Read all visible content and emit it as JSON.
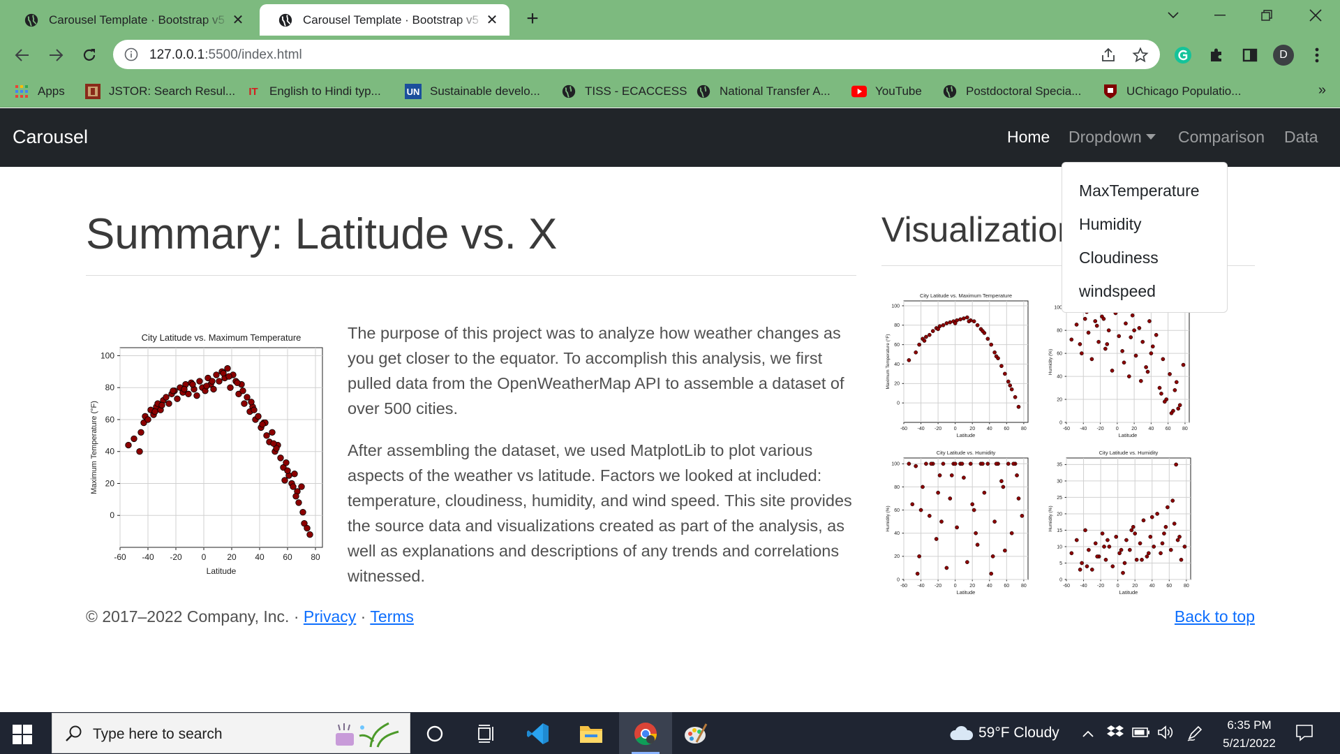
{
  "browser": {
    "tabs": [
      {
        "title": "Carousel Template · Bootstrap v5",
        "active": false
      },
      {
        "title": "Carousel Template · Bootstrap v5",
        "active": true
      }
    ],
    "url_host": "127.0.0.1",
    "url_path": ":5500/index.html",
    "profile_initial": "D",
    "bookmarks": [
      {
        "label": "Apps",
        "icon": "apps-grid-icon"
      },
      {
        "label": "JSTOR: Search Resul...",
        "icon": "jstor-icon"
      },
      {
        "label": "English to Hindi typ...",
        "icon": "it-icon",
        "glyph": "IT"
      },
      {
        "label": "Sustainable develo...",
        "icon": "un-icon",
        "glyph": "UN"
      },
      {
        "label": "TISS - ECACCESS",
        "icon": "globe-icon"
      },
      {
        "label": "National Transfer A...",
        "icon": "globe-icon"
      },
      {
        "label": "YouTube",
        "icon": "youtube-icon"
      },
      {
        "label": "Postdoctoral Specia...",
        "icon": "globe-icon"
      },
      {
        "label": "UChicago Populatio...",
        "icon": "uchicago-icon"
      }
    ],
    "more_bookmarks": "»"
  },
  "navbar": {
    "brand": "Carousel",
    "links": [
      {
        "label": "Home",
        "active": true
      },
      {
        "label": "Dropdown",
        "active": false
      },
      {
        "label": "Comparison",
        "active": false
      },
      {
        "label": "Data",
        "active": false
      }
    ],
    "dropdown_items": [
      "MaxTemperature",
      "Humidity",
      "Cloudiness",
      "windspeed"
    ]
  },
  "main": {
    "summary_title": "Summary: Latitude vs. X",
    "paragraph_1": "The purpose of this project was to analyze how weather changes as you get closer to the equator. To accomplish this analysis, we first pulled data from the OpenWeatherMap API to assemble a dataset of over 500 cities.",
    "paragraph_2": "After assembling the dataset, we used MatplotLib to plot various aspects of the weather vs latitude. Factors we looked at included: temperature, cloudiness, humidity, and wind speed. This site provides the source data and visualizations created as part of the analysis, as well as explanations and descriptions of any trends and correlations witnessed.",
    "visualizations_title": "Visualizations"
  },
  "footer": {
    "copyright": "© 2017–2022 Company, Inc. · ",
    "privacy": "Privacy",
    "separator": " · ",
    "terms": "Terms",
    "back_to_top": "Back to top"
  },
  "taskbar": {
    "search_placeholder": "Type here to search",
    "weather": "59°F  Cloudy",
    "time": "6:35 PM",
    "date": "5/21/2022"
  },
  "colors": {
    "navbar_bg": "#212529",
    "chrome_green": "#7dba7f",
    "link": "#0d6efd",
    "marker": "#8b0000"
  },
  "chart_data": [
    {
      "type": "scatter",
      "title": "City Latitude vs. Maximum Temperature",
      "xlabel": "Latitude",
      "ylabel": "Maximum Temperature (°F)",
      "xlim": [
        -60,
        85
      ],
      "ylim": [
        -20,
        105
      ],
      "xticks": [
        -60,
        -40,
        -20,
        0,
        20,
        40,
        60,
        80
      ],
      "yticks": [
        0,
        20,
        40,
        60,
        80,
        100
      ],
      "grid": true,
      "x": [
        -54,
        -50,
        -46,
        -45,
        -43,
        -42,
        -40,
        -38,
        -36,
        -34,
        -33,
        -31,
        -29,
        -27,
        -25,
        -23,
        -21,
        -19,
        -17,
        -15,
        -13,
        -11,
        -9,
        -7,
        -5,
        -3,
        -1,
        1,
        3,
        5,
        7,
        9,
        11,
        13,
        15,
        17,
        19,
        21,
        23,
        25,
        27,
        29,
        31,
        33,
        35,
        37,
        39,
        41,
        43,
        45,
        47,
        49,
        51,
        53,
        55,
        57,
        59,
        61,
        63,
        65,
        67,
        68,
        70,
        72,
        74,
        76,
        -35,
        -22,
        -8,
        6,
        18,
        28,
        36,
        44,
        52,
        60,
        66,
        -30,
        -14,
        2,
        14,
        24,
        34,
        42,
        50,
        58,
        64,
        71
      ],
      "y": [
        44,
        48,
        40,
        52,
        58,
        62,
        60,
        66,
        63,
        68,
        70,
        66,
        72,
        74,
        70,
        76,
        78,
        73,
        80,
        77,
        82,
        76,
        83,
        79,
        75,
        84,
        80,
        78,
        86,
        82,
        79,
        88,
        84,
        90,
        86,
        92,
        80,
        88,
        84,
        76,
        82,
        70,
        74,
        65,
        68,
        60,
        62,
        55,
        58,
        50,
        46,
        52,
        40,
        44,
        36,
        30,
        33,
        25,
        20,
        26,
        15,
        8,
        18,
        -5,
        -8,
        -12,
        65,
        78,
        82,
        84,
        87,
        78,
        66,
        58,
        42,
        28,
        12,
        69,
        79,
        81,
        89,
        83,
        71,
        57,
        45,
        22,
        18,
        2
      ],
      "marker_color": "#8b0000"
    },
    {
      "type": "scatter",
      "title": "City Latitude vs. Maximum Temperature",
      "xlabel": "Latitude",
      "ylabel": "Maximum Temperature (°F)",
      "xlim": [
        -60,
        85
      ],
      "ylim": [
        -20,
        105
      ],
      "xticks": [
        -60,
        -40,
        -20,
        0,
        20,
        40,
        60,
        80
      ],
      "yticks": [
        0,
        20,
        40,
        60,
        80,
        100
      ],
      "grid": true,
      "x": [
        -54,
        -46,
        -42,
        -38,
        -34,
        -30,
        -26,
        -22,
        -18,
        -14,
        -10,
        -6,
        -2,
        2,
        6,
        10,
        14,
        18,
        22,
        26,
        30,
        34,
        38,
        42,
        46,
        50,
        54,
        58,
        62,
        66,
        70,
        74,
        -36,
        -20,
        0,
        16,
        32,
        48,
        64
      ],
      "y": [
        44,
        52,
        60,
        66,
        68,
        70,
        74,
        77,
        79,
        80,
        82,
        83,
        84,
        85,
        86,
        87,
        88,
        85,
        84,
        80,
        76,
        72,
        66,
        60,
        52,
        46,
        38,
        30,
        22,
        14,
        6,
        -4,
        64,
        76,
        82,
        84,
        74,
        48,
        18
      ],
      "marker_color": "#8b0000"
    },
    {
      "type": "scatter",
      "title": "",
      "xlabel": "Latitude",
      "ylabel": "Humidity (%)",
      "xlim": [
        -60,
        85
      ],
      "ylim": [
        0,
        105
      ],
      "xticks": [
        -60,
        -40,
        -20,
        0,
        20,
        40,
        60,
        80
      ],
      "yticks": [
        0,
        20,
        40,
        60,
        80,
        100
      ],
      "grid": true,
      "x": [
        -54,
        -48,
        -42,
        -38,
        -34,
        -30,
        -26,
        -22,
        -18,
        -14,
        -10,
        -6,
        -2,
        2,
        6,
        10,
        14,
        18,
        22,
        26,
        30,
        34,
        38,
        42,
        46,
        50,
        54,
        58,
        62,
        66,
        70,
        74,
        78,
        -36,
        -24,
        -12,
        4,
        16,
        28,
        40,
        52,
        64,
        72,
        -44,
        -16,
        8,
        20,
        36,
        56,
        68
      ],
      "y": [
        72,
        85,
        60,
        90,
        78,
        55,
        88,
        70,
        92,
        64,
        80,
        45,
        95,
        75,
        62,
        86,
        40,
        93,
        58,
        82,
        70,
        48,
        88,
        66,
        76,
        30,
        55,
        20,
        42,
        10,
        35,
        15,
        50,
        96,
        84,
        68,
        98,
        74,
        36,
        60,
        25,
        8,
        12,
        68,
        90,
        52,
        80,
        44,
        18,
        28
      ],
      "marker_color": "#8b0000"
    },
    {
      "type": "scatter",
      "title": "City Latitude vs. Humidity",
      "xlabel": "Latitude",
      "ylabel": "Humidity (%)",
      "xlim": [
        -60,
        85
      ],
      "ylim": [
        0,
        105
      ],
      "xticks": [
        -60,
        -40,
        -20,
        0,
        20,
        40,
        60,
        80
      ],
      "yticks": [
        0,
        20,
        40,
        60,
        80,
        100
      ],
      "grid": true,
      "x": [
        -54,
        -50,
        -46,
        -42,
        -38,
        -34,
        -30,
        -26,
        -22,
        -18,
        -14,
        -10,
        -6,
        -2,
        2,
        6,
        10,
        14,
        18,
        22,
        26,
        30,
        34,
        38,
        42,
        46,
        50,
        54,
        58,
        62,
        66,
        70,
        74,
        78,
        -40,
        -28,
        -16,
        -4,
        8,
        20,
        32,
        44,
        56,
        68,
        -44,
        -20,
        0,
        24,
        48,
        72
      ],
      "y": [
        100,
        65,
        98,
        20,
        80,
        100,
        55,
        100,
        35,
        90,
        100,
        10,
        70,
        100,
        45,
        100,
        88,
        15,
        100,
        60,
        30,
        100,
        75,
        100,
        5,
        50,
        100,
        85,
        25,
        100,
        40,
        100,
        70,
        55,
        60,
        100,
        50,
        90,
        100,
        65,
        100,
        20,
        80,
        100,
        5,
        75,
        100,
        40,
        100,
        90
      ],
      "marker_color": "#8b0000"
    },
    {
      "type": "scatter",
      "title": "City Latitude vs. Humidity",
      "xlabel": "Latitude",
      "ylabel": "Humidity (%)",
      "xlim": [
        -60,
        85
      ],
      "ylim": [
        0,
        37
      ],
      "xticks": [
        -60,
        -40,
        -20,
        0,
        20,
        40,
        60,
        80
      ],
      "yticks": [
        0,
        5,
        10,
        15,
        20,
        25,
        30,
        35
      ],
      "grid": true,
      "x": [
        -54,
        -48,
        -42,
        -38,
        -34,
        -30,
        -26,
        -22,
        -18,
        -14,
        -10,
        -6,
        -2,
        2,
        6,
        10,
        14,
        18,
        22,
        26,
        30,
        34,
        38,
        42,
        46,
        50,
        54,
        58,
        62,
        66,
        70,
        74,
        78,
        -36,
        -24,
        -12,
        4,
        16,
        28,
        40,
        52,
        64,
        72,
        -44,
        -16,
        8,
        20,
        36,
        56,
        68
      ],
      "y": [
        8,
        12,
        5,
        15,
        9,
        3,
        11,
        7,
        14,
        6,
        10,
        4,
        13,
        8,
        2,
        12,
        9,
        16,
        6,
        11,
        18,
        7,
        13,
        10,
        20,
        8,
        14,
        22,
        9,
        17,
        12,
        6,
        10,
        4,
        7,
        12,
        9,
        15,
        6,
        19,
        11,
        24,
        13,
        3,
        10,
        5,
        14,
        8,
        16,
        35
      ],
      "marker_color": "#8b0000"
    }
  ]
}
